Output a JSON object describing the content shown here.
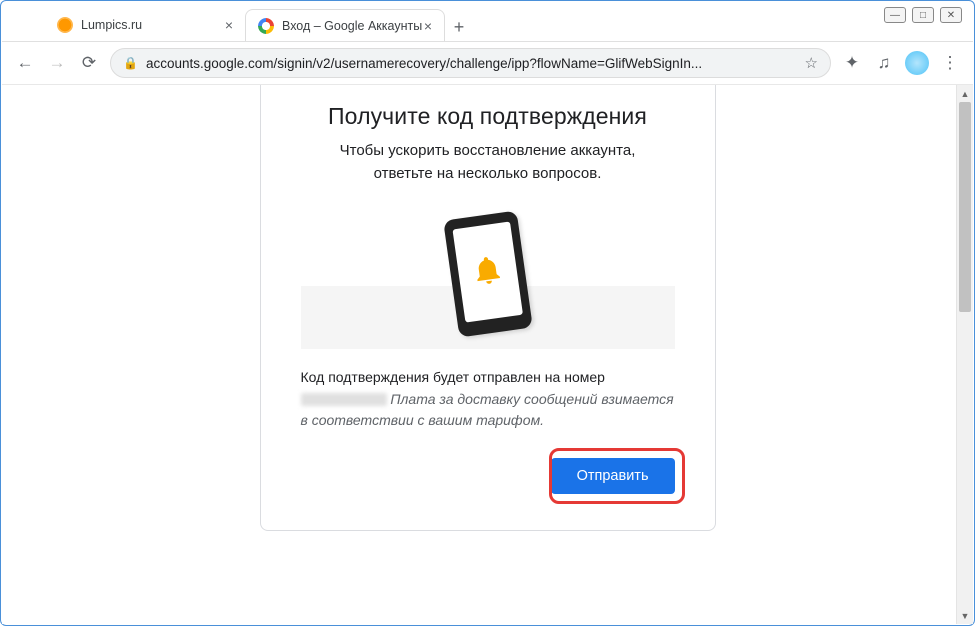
{
  "window": {
    "minimize": "—",
    "maximize": "□",
    "close": "✕"
  },
  "tabs": [
    {
      "title": "Lumpics.ru",
      "active": false
    },
    {
      "title": "Вход – Google Аккаунты",
      "active": true
    }
  ],
  "toolbar": {
    "back": "←",
    "forward": "→",
    "reload": "⟳",
    "url": "accounts.google.com/signin/v2/usernamerecovery/challenge/ipp?flowName=GlifWebSignIn...",
    "star": "☆",
    "ext": "✦",
    "media": "♫",
    "menu": "⋮"
  },
  "card": {
    "title": "Получите код подтверждения",
    "subtitle_l1": "Чтобы ускорить восстановление аккаунта,",
    "subtitle_l2": "ответьте на несколько вопросов.",
    "desc_prefix": "Код подтверждения будет отправлен на номер",
    "desc_note": "Плата за доставку сообщений взимается в соответствии с вашим тарифом.",
    "send": "Отправить"
  }
}
